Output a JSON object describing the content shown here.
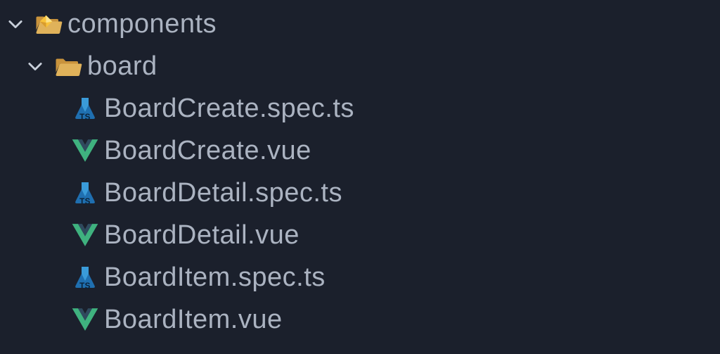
{
  "tree": {
    "components": {
      "label": "components",
      "children": {
        "board": {
          "label": "board",
          "files": [
            {
              "label": "BoardCreate.spec.ts",
              "icon": "flask-ts"
            },
            {
              "label": "BoardCreate.vue",
              "icon": "vue"
            },
            {
              "label": "BoardDetail.spec.ts",
              "icon": "flask-ts"
            },
            {
              "label": "BoardDetail.vue",
              "icon": "vue"
            },
            {
              "label": "BoardItem.spec.ts",
              "icon": "flask-ts"
            },
            {
              "label": "BoardItem.vue",
              "icon": "vue"
            }
          ]
        }
      }
    }
  }
}
